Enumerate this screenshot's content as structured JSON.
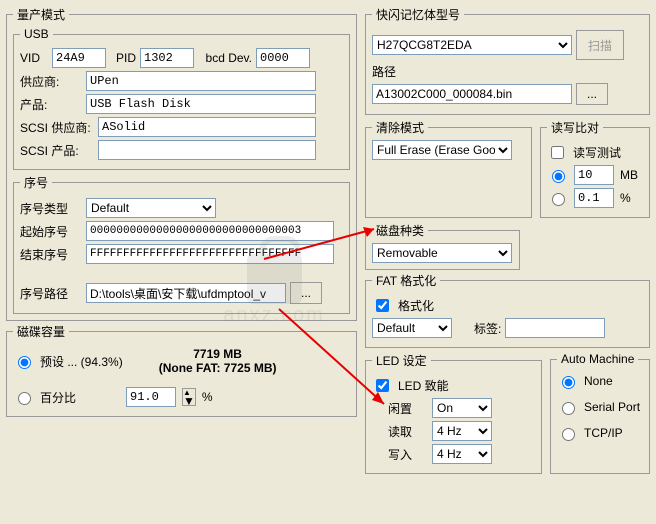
{
  "mp": {
    "title": "量产模式",
    "usb": {
      "title": "USB",
      "vid_lbl": "VID",
      "vid": "24A9",
      "pid_lbl": "PID",
      "pid": "1302",
      "bcd_lbl": "bcd Dev.",
      "bcd": "0000",
      "vendor_lbl": "供应商:",
      "vendor": "UPen",
      "product_lbl": "产品:",
      "product": "USB Flash Disk",
      "scsi_vendor_lbl": "SCSI 供应商:",
      "scsi_vendor": "ASolid",
      "scsi_product_lbl": "SCSI 产品:",
      "scsi_product": ""
    },
    "serial": {
      "title": "序号",
      "type_lbl": "序号类型",
      "type": "Default",
      "start_lbl": "起始序号",
      "start": "00000000000000000000000000000003",
      "end_lbl": "结束序号",
      "end": "FFFFFFFFFFFFFFFFFFFFFFFFFFFFFFFF",
      "path_lbl": "序号路径",
      "path": "D:\\tools\\桌面\\安下载\\ufdmptool_v",
      "browse": "..."
    },
    "capacity": {
      "title": "磁碟容量",
      "preset_lbl": "预设 ... (94.3%)",
      "preset_value": "7719  MB",
      "preset_sub": "(None FAT: 7725 MB)",
      "percent_lbl": "百分比",
      "percent_val": "91.0",
      "percent_unit": "%"
    }
  },
  "flash": {
    "title": "快闪记忆体型号",
    "model": "H27QCG8T2EDA",
    "scan": "扫描",
    "path_lbl": "路径",
    "path": "A13002C000_000084.bin",
    "browse": "..."
  },
  "erase": {
    "title": "清除模式",
    "mode": "Full Erase (Erase Good)"
  },
  "rw": {
    "title": "读写比对",
    "test_lbl": "读写测试",
    "opt1": "10",
    "unit1": "MB",
    "opt2": "0.1",
    "unit2": "%"
  },
  "disktype": {
    "title": "磁盘种类",
    "value": "Removable"
  },
  "fat": {
    "title": "FAT 格式化",
    "format_lbl": "格式化",
    "default": "Default",
    "label_lbl": "标签:",
    "label": ""
  },
  "led": {
    "title": "LED 设定",
    "enable": "LED 致能",
    "idle_lbl": "闲置",
    "idle": "On",
    "read_lbl": "读取",
    "read": "4 Hz",
    "write_lbl": "写入",
    "write": "4 Hz"
  },
  "auto": {
    "title": "Auto Machine",
    "none": "None",
    "serial": "Serial Port",
    "tcp": "TCP/IP"
  }
}
